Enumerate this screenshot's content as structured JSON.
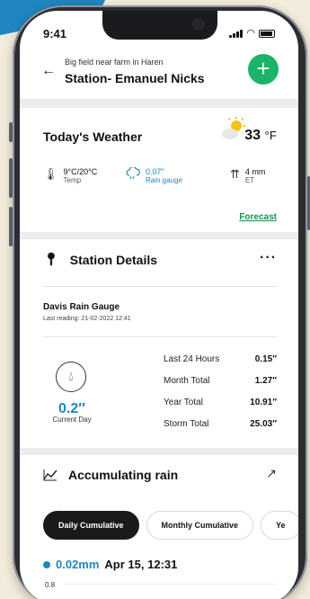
{
  "status": {
    "time": "9:41"
  },
  "header": {
    "subtitle": "Big field near farm in Haren",
    "title": "Station- Emanuel Nicks",
    "back_icon": "arrow-left-icon",
    "add_icon": "plus-icon"
  },
  "weather": {
    "title": "Today's Weather",
    "temperature": "33",
    "unit": "°F",
    "temp_value": "9°C/20°C",
    "temp_label": "Temp",
    "rain_value": "0.07\"",
    "rain_label": "Rain gauge",
    "et_value": "4 mm",
    "et_label": "ET",
    "forecast_link": "Forecast"
  },
  "station": {
    "title": "Station Details",
    "gauge_name": "Davis Rain Gauge",
    "last_reading": "Last reading: 21-02-2022  12:41",
    "current_value": "0.2″",
    "current_label": "Current Day",
    "rows": [
      {
        "label": "Last 24 Hours",
        "value": "0.15″"
      },
      {
        "label": "Month Total",
        "value": "1.27″"
      },
      {
        "label": "Year Total",
        "value": "10.91″"
      },
      {
        "label": "Storm Total",
        "value": "25.03″"
      }
    ]
  },
  "accumulating": {
    "title": "Accumulating rain",
    "tabs": [
      "Daily Cumulative",
      "Monthly Cumulative",
      "Ye"
    ],
    "reading_value": "0.02mm",
    "reading_date": "Apr 15, 12:31",
    "y_tick": "0.8"
  },
  "colors": {
    "accent_green": "#1db368",
    "accent_blue": "#1f86c0"
  }
}
